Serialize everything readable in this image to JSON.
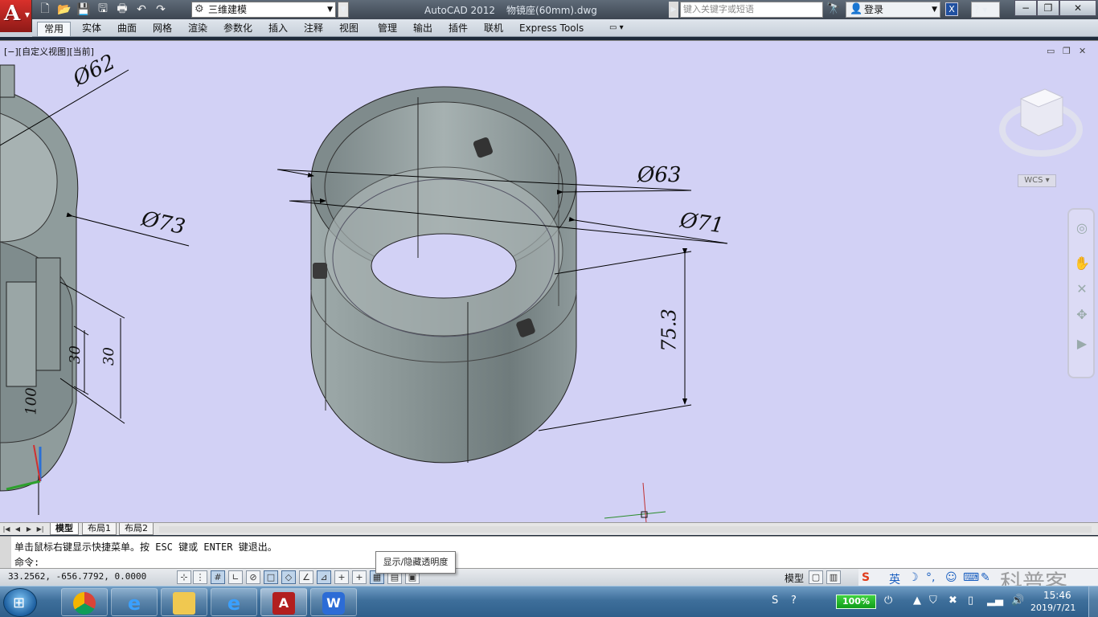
{
  "app": {
    "title": "AutoCAD 2012",
    "filename": "物镜座(60mm).dwg",
    "workspace": "三维建模",
    "search_placeholder": "键入关键字或短语",
    "login_label": "登录",
    "help_label": "?"
  },
  "quick_access": [
    "new-icon",
    "open-icon",
    "save-icon",
    "saveas-icon",
    "print-icon",
    "undo-icon",
    "redo-icon"
  ],
  "ribbon_tabs": [
    "常用",
    "实体",
    "曲面",
    "网格",
    "渲染",
    "参数化",
    "插入",
    "注释",
    "视图",
    "管理",
    "输出",
    "插件",
    "联机",
    "Express Tools"
  ],
  "ribbon_active": "常用",
  "viewport": {
    "label": "[−][自定义视图][当前]",
    "background": "#d2d1f5",
    "wcs_label": "WCS",
    "dimensions": {
      "d62": "Ø62",
      "d73": "Ø73",
      "d63": "Ø63",
      "d71": "Ø71",
      "h75": "75.3",
      "d30a": "30",
      "d30b": "30",
      "d100": "100"
    }
  },
  "layout_tabs": [
    "模型",
    "布局1",
    "布局2"
  ],
  "layout_active": "模型",
  "command": {
    "line1": "单击鼠标右键显示快捷菜单。按 ESC 键或 ENTER 键退出。",
    "prompt": "命令:"
  },
  "tooltip": "显示/隐藏透明度",
  "status": {
    "coords": "33.2562,   -656.7792, 0.0000",
    "model_label": "模型"
  },
  "ime": {
    "lang": "英"
  },
  "taskbar": {
    "apps": [
      "chrome-icon",
      "ie-icon",
      "explorer-icon",
      "ie-icon-2",
      "autocad-icon",
      "wps-icon"
    ],
    "battery": "100%",
    "time": "15:46",
    "date": "2019/7/21"
  },
  "watermark": "科普客"
}
